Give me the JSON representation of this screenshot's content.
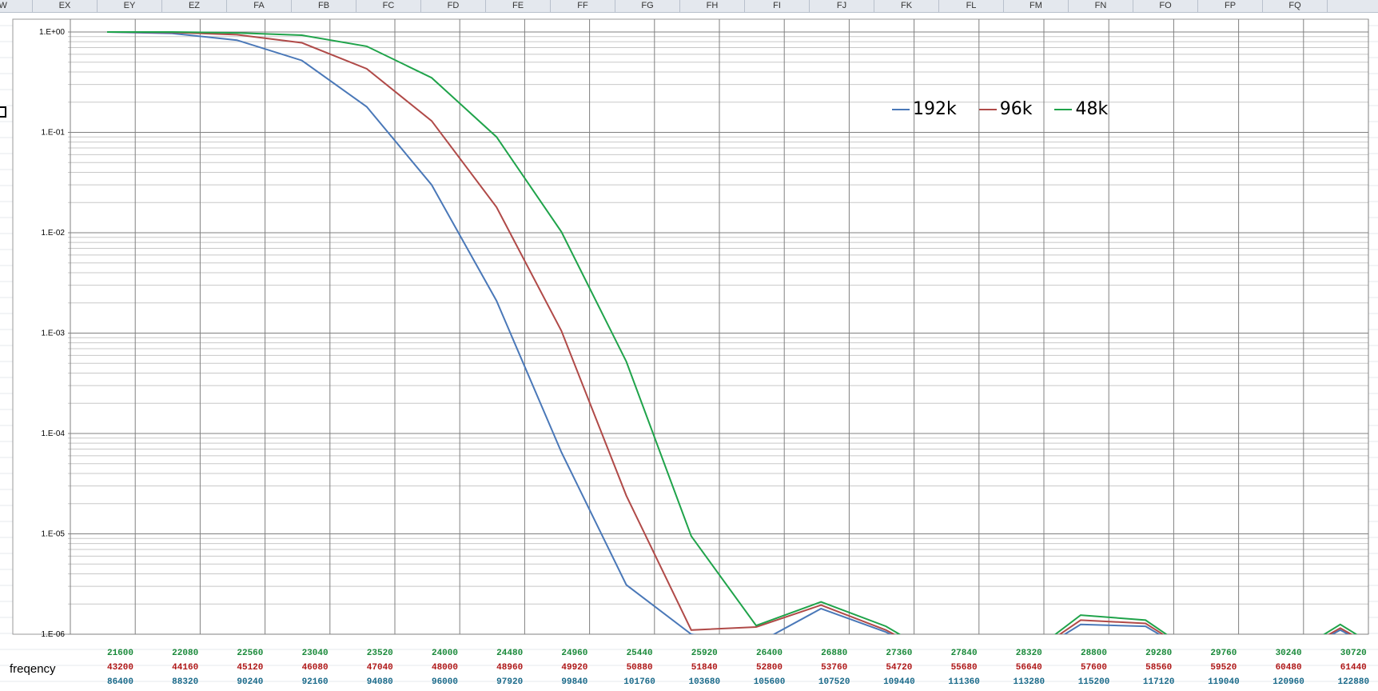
{
  "column_headers": [
    "EW",
    "EX",
    "EY",
    "EZ",
    "FA",
    "FB",
    "FC",
    "FD",
    "FE",
    "FF",
    "FG",
    "FH",
    "FI",
    "FJ",
    "FK",
    "FL",
    "FM",
    "FN",
    "FO",
    "FP",
    "FQ"
  ],
  "row_label": "freqency",
  "colors": {
    "192k": "#4a78b8",
    "96k": "#b04a48",
    "48k": "#1fa34a",
    "freq_green": "#1a8a3a",
    "freq_red": "#b01818",
    "freq_teal": "#1a6a8a"
  },
  "chart_data": {
    "type": "line",
    "y_scale": "log",
    "ylim": [
      1e-06,
      1
    ],
    "y_tick_labels": [
      "1.E+00",
      "1.E-01",
      "1.E-02",
      "1.E-03",
      "1.E-04",
      "1.E-05",
      "1.E-06"
    ],
    "x_tick_rows": {
      "48k": [
        "21600",
        "22080",
        "22560",
        "23040",
        "23520",
        "24000",
        "24480",
        "24960",
        "25440",
        "25920",
        "26400",
        "26880",
        "27360",
        "27840",
        "28320",
        "28800",
        "29280",
        "29760",
        "30240",
        "30720"
      ],
      "96k": [
        "43200",
        "44160",
        "45120",
        "46080",
        "47040",
        "48000",
        "48960",
        "49920",
        "50880",
        "51840",
        "52800",
        "53760",
        "54720",
        "55680",
        "56640",
        "57600",
        "58560",
        "59520",
        "60480",
        "61440"
      ],
      "192k": [
        "86400",
        "88320",
        "90240",
        "92160",
        "94080",
        "96000",
        "97920",
        "99840",
        "101760",
        "103680",
        "105600",
        "107520",
        "109440",
        "111360",
        "113280",
        "115200",
        "117120",
        "119040",
        "120960",
        "122880"
      ]
    },
    "legend_placement": "top-right",
    "grid": true,
    "series": [
      {
        "name": "192k",
        "values": [
          1.0,
          0.97,
          0.83,
          0.52,
          0.18,
          0.03,
          0.0021,
          6.5e-05,
          3.1e-06,
          1e-06,
          8e-07,
          1.8e-06,
          1.05e-06,
          5e-07,
          5e-07,
          1.25e-06,
          1.2e-06,
          5e-07,
          5e-07,
          1.1e-06,
          5e-07
        ]
      },
      {
        "name": "96k",
        "values": [
          1.0,
          0.99,
          0.94,
          0.78,
          0.43,
          0.13,
          0.018,
          0.00105,
          2.4e-05,
          1.1e-06,
          1.18e-06,
          1.95e-06,
          1.1e-06,
          5e-07,
          5e-07,
          1.38e-06,
          1.28e-06,
          5e-07,
          5e-07,
          1.15e-06,
          5e-07
        ]
      },
      {
        "name": "48k",
        "values": [
          1.0,
          1.0,
          0.98,
          0.93,
          0.72,
          0.35,
          0.09,
          0.0102,
          0.00052,
          9.5e-06,
          1.22e-06,
          2.1e-06,
          1.2e-06,
          5e-07,
          5e-07,
          1.55e-06,
          1.38e-06,
          5e-07,
          5e-07,
          1.25e-06,
          5e-07
        ]
      }
    ]
  }
}
